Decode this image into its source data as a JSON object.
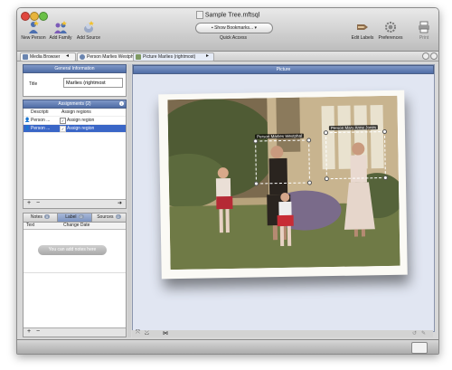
{
  "window": {
    "title": "Sample Tree.mftsql",
    "toolbar": {
      "new_person": "New Person",
      "add_family": "Add Family",
      "add_source": "Add Source",
      "show_bookmarks": "Show Bookmarks...",
      "quick_access": "Quick Access",
      "edit_labels": "Edit Labels",
      "preferences": "Preferences",
      "print": "Print"
    }
  },
  "breadcrumbs": [
    {
      "label": "Media Browser"
    },
    {
      "label": "Person Marlies Westphal"
    },
    {
      "label": "Picture Marlies (rightmost)"
    }
  ],
  "general_information": {
    "header": "General Information",
    "title_label": "Title",
    "title_value": "Marlies (rightmost"
  },
  "assignments": {
    "header": "Assignments",
    "count": "(2)",
    "rows": [
      {
        "description": "Descripti",
        "action": "Assign regions"
      },
      {
        "description": "Person ...",
        "action": "Assign region"
      },
      {
        "description": "Person ...",
        "action": "Assign region"
      }
    ]
  },
  "notes": {
    "tabs": [
      {
        "label": "Notes",
        "count": "0"
      },
      {
        "label": "Label",
        "count": "0"
      },
      {
        "label": "Sources",
        "count": "0"
      }
    ],
    "columns": [
      "Text",
      "Change Date"
    ],
    "add_notes_button": "You can add notes here"
  },
  "picture": {
    "header": "Picture",
    "tags": [
      {
        "label": "Person Marlies Westphal"
      },
      {
        "label": "Person Mary Anne Jones"
      }
    ]
  },
  "colors": {
    "header_blue": "#5d79ad",
    "selected_row": "#3a66c7",
    "picture_bg": "#e1e6f2"
  }
}
